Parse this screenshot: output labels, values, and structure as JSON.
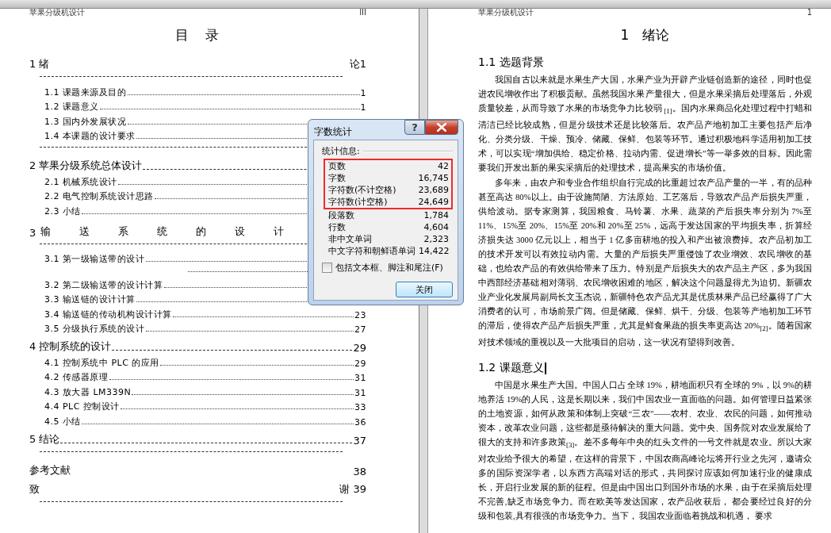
{
  "left_page": {
    "header": {
      "title": "苹果分级机设计",
      "page": "III"
    },
    "title": "目　录",
    "toc": [
      {
        "kind": "split",
        "left": "1 绪",
        "right": "论1"
      },
      {
        "kind": "rule"
      },
      {
        "kind": "section",
        "title": "1.1 课题来源及目的",
        "page": "1"
      },
      {
        "kind": "section",
        "title": "1.2 课题意义",
        "page": "1"
      },
      {
        "kind": "section",
        "title": "1.3 国内外发展状况"
      },
      {
        "kind": "section",
        "title": "1.4 本课题的设计要求"
      },
      {
        "kind": "rule"
      },
      {
        "kind": "chapter",
        "title": "2 苹果分级系统总体设计"
      },
      {
        "kind": "section",
        "title": "2.1 机械系统设计"
      },
      {
        "kind": "section",
        "title": "2.2 电气控制系统设计思路"
      },
      {
        "kind": "section",
        "title": "2.3 小结"
      },
      {
        "kind": "spread",
        "number": "3",
        "title": "输送系统的设计"
      },
      {
        "kind": "rule"
      },
      {
        "kind": "section",
        "title": "3.1 第一级输送带的设计"
      },
      {
        "kind": "dots"
      },
      {
        "kind": "section",
        "title": "3.2 第二级输送带的设计计算"
      },
      {
        "kind": "section",
        "title": "3.3 输送链的设计计算"
      },
      {
        "kind": "section",
        "title": "3.4 输送链的传动机构设计计算",
        "page": "23"
      },
      {
        "kind": "section",
        "title": "3.5 分级执行系统的设计",
        "page": "27"
      },
      {
        "kind": "chapter",
        "title": "4 控制系统的设计",
        "page": "29"
      },
      {
        "kind": "section",
        "title": "4.1 控制系统中 PLC 的应用",
        "page": "29"
      },
      {
        "kind": "section",
        "title": "4.2 传感器原理",
        "page": "31"
      },
      {
        "kind": "section",
        "title": "4.3 放大器 LM339N",
        "page": "31"
      },
      {
        "kind": "section",
        "title": "4.4 PLC 控制设计",
        "page": "33"
      },
      {
        "kind": "section",
        "title": "4.5 小结",
        "page": "36"
      },
      {
        "kind": "chapter",
        "title": "5 结论",
        "page": "37"
      },
      {
        "kind": "rule"
      },
      {
        "kind": "plain",
        "title": "参考文献",
        "page": "38"
      },
      {
        "kind": "split",
        "left": "致",
        "right": "谢 39"
      },
      {
        "kind": "rule"
      }
    ]
  },
  "right_page": {
    "header": {
      "title": "苹果分级机设计",
      "page": "1"
    },
    "title": "1　绪论",
    "blocks": [
      {
        "kind": "heading",
        "text": "1.1 选题背景"
      },
      {
        "kind": "paragraph",
        "text": "我国自古以来就是水果生产大国，水果产业为开辟产业链创造新的途径，同时也促进农民增收作出了积极贡献。虽然我国水果产量很大，但是水果采摘后处理落后，外观质量较差，从而导致了水果的市场竞争力比较弱 $_{[1]}$。国内水果商品化处理过程中打蜡和清洁已经比较成熟，但是分级技术还是比较落后。农产品产地初加工主要包括产后净化、分类分级、干燥、预冷、储藏、保鲜、包装等环节。通过积极地科学适用初加工技术，可以实现“增加供给、稳定价格、拉动内需、促进增长”等一举多效的目标。因此需要我们开发出新的果实采摘后的处理技术，提高果实的市场价值。"
      },
      {
        "kind": "paragraph",
        "text": "多年来，由农户和专业合作组织自行完成的比重超过农产品产量的一半，有的品种甚至高达 80%以上。由于设施简陋、方法原始、工艺落后，导致农产品产后损失严重，供给波动。据专家测算，我国粮食、马铃薯、水果、蔬菜的产后损失率分别为 7%至 11%、15%至 20%、15%至 20%和 20%至 25%，远高于发达国家的平均损失率，折算经济损失达 3000 亿元以上，相当于 1 亿多亩耕地的投入和产出被浪费掉。农产品初加工的技术开发可以有效拉动内需。大量的产后损失严重侵蚀了农业增效、农民增收的基础，也给农产品的有效供给带来了压力。特别是产后损失大的农产品主产区，多为我国中西部经济基础相对薄弱、农民增收困难的地区，解决这个问题显得尤为迫切。新疆农业产业化发展局副局长文玉杰说，新疆特色农产品尤其是优质林果产品已经赢得了广大消费者的认可，市场前景广阔。但是储藏、保鲜、烘干、分级、包装等产地初加工环节的滞后，使得农产品产后损失严重，尤其是鲜食果蔬的损失率更高达 20%$_{[2]}$。随着国家对技术领域的重视以及一大批项目的启动，这一状况有望得到改善。"
      },
      {
        "kind": "heading",
        "text": "1.2 课题意义",
        "cursor": true
      },
      {
        "kind": "paragraph",
        "text": "中国是水果生产大国。中国人口占全球 19%，耕地面积只有全球的 9%，以 9%的耕地养活 19%的人民，这是长期以来，我们中国农业一直面临的问题。如何管理日益紧张的土地资源，如何从政策和体制上突破“三农”——农村、农业、农民的问题，如何推动资本，改革农业问题，这些都是亟待解决的重大问题。党中央、国务院对农业发展给了很大的支持和许多政策$_{[3]}$。差不多每年中央的红头文件的一号文件就是农业。所以大家对农业给予很大的希望，在这样的背景下，中国农商高峰论坛将开行业之先河，邀请众多的国际资深学者，以东西方高端对话的形式，共同探讨应该如何加速行业的健康成长，开启行业发展的新的征程。但是由中国出口到国外市场的水果，由于在采摘后处理不完善,缺乏市场竞争力。而在欧美等发达国家，农产品收获后， 都会要经过良好的分级和包装,具有很强的市场竞争力。当下， 我国农业面临着挑战和机遇， 要求"
      }
    ]
  },
  "dialog": {
    "title": "字数统计",
    "help_button": "?",
    "group_label": "统计信息:",
    "stats": [
      {
        "label": "页数",
        "value": "42",
        "highlighted": true
      },
      {
        "label": "字数",
        "value": "16,745",
        "highlighted": true
      },
      {
        "label": "字符数(不计空格)",
        "value": "23,689",
        "highlighted": true
      },
      {
        "label": "字符数(计空格)",
        "value": "24,649",
        "highlighted": true
      },
      {
        "label": "段落数",
        "value": "1,784",
        "highlighted": false
      },
      {
        "label": "行数",
        "value": "4,604",
        "highlighted": false
      },
      {
        "label": "非中文单词",
        "value": "2,323",
        "highlighted": false
      },
      {
        "label": "中文字符和朝鲜语单词",
        "value": "14,422",
        "highlighted": false
      }
    ],
    "checkbox": {
      "label": "包括文本框、脚注和尾注(F)",
      "checked": false
    },
    "button": "关闭"
  }
}
